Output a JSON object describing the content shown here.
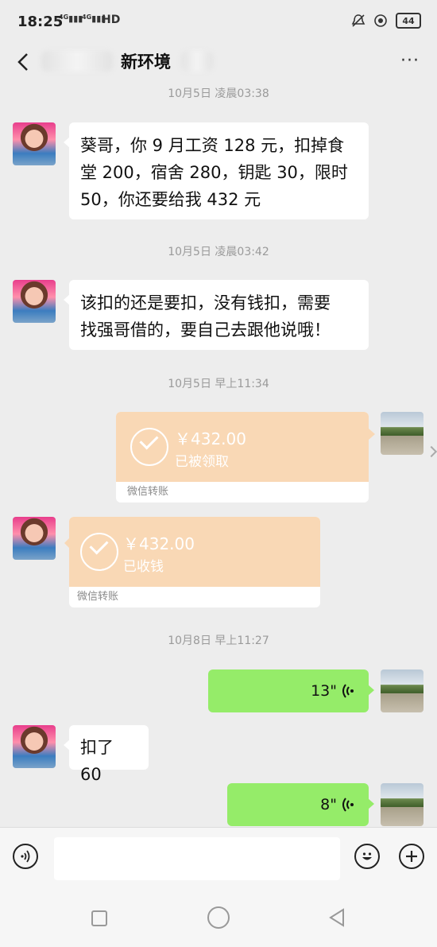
{
  "status_bar": {
    "time": "18:25",
    "signal_1": "4G",
    "signal_2": "4G",
    "hd_label": "HD",
    "battery": "44"
  },
  "header": {
    "title": "新环境",
    "back_icon": "chevron-left-icon",
    "more_label": "···"
  },
  "messages": [
    {
      "type": "timestamp",
      "text": "10月5日 凌晨03:38"
    },
    {
      "type": "text",
      "side": "left",
      "lines": [
        "葵哥，你 9 月工资 128 元，扣掉食",
        "堂 200，宿舍 280，钥匙 30，限时",
        "50，你还要给我 432 元"
      ]
    },
    {
      "type": "timestamp",
      "text": "10月5日 凌晨03:42"
    },
    {
      "type": "text",
      "side": "left",
      "lines": [
        "该扣的还是要扣，没有钱扣，需要",
        "找强哥借的，要自己去跟他说哦！"
      ]
    },
    {
      "type": "timestamp",
      "text": "10月5日 早上11:34"
    },
    {
      "type": "transfer",
      "side": "right",
      "amount": "￥432.00",
      "status": "已被领取",
      "label": "微信转账"
    },
    {
      "type": "transfer",
      "side": "left",
      "amount": "￥432.00",
      "status": "已收钱",
      "label": "微信转账"
    },
    {
      "type": "timestamp",
      "text": "10月8日 早上11:27"
    },
    {
      "type": "voice",
      "side": "right",
      "duration": "13\""
    },
    {
      "type": "text",
      "side": "left",
      "lines": [
        "扣了 60"
      ]
    },
    {
      "type": "voice",
      "side": "right",
      "duration": "8\""
    }
  ],
  "input_bar": {
    "voice_icon": "voice-input-icon",
    "emoji_icon": "emoji-icon",
    "plus_icon": "plus-icon"
  },
  "nav_bar": {
    "recent_icon": "square-recent-icon",
    "home_icon": "circle-home-icon",
    "back_icon": "triangle-back-icon"
  },
  "colors": {
    "background": "#ededed",
    "sent_bubble": "#95ec69",
    "received_bubble": "#ffffff",
    "transfer_card": "#f9d8b5"
  }
}
